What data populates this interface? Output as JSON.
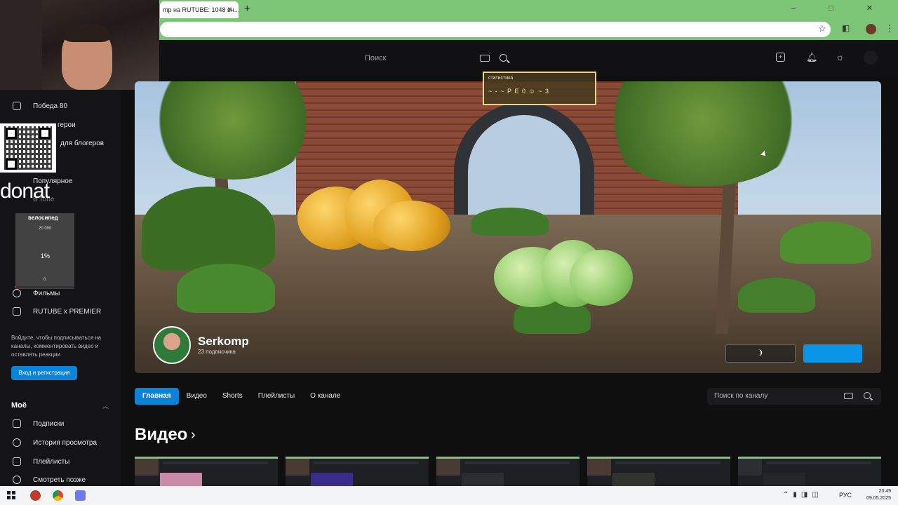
{
  "browser": {
    "tab_title": "mp на RUTUBE: 1048 вн...",
    "tab_close": "×",
    "new_tab": "+",
    "window_controls": "– □ ✕"
  },
  "header": {
    "search_placeholder": "Поиск"
  },
  "sidebar": {
    "items": [
      {
        "label": "Победа 80"
      },
      {
        "label": "герои"
      },
      {
        "label": "для блогеров"
      },
      {
        "label": "Популярное"
      },
      {
        "label": "В топе"
      },
      {
        "label": "Фильмы"
      },
      {
        "label": "RUTUBE x PREMIER"
      }
    ],
    "description": "Войдите, чтобы подписываться на каналы, комментировать видео и оставлять реакции",
    "login_button": "Вход и регистрация",
    "my_section": "Моё",
    "my_items": [
      {
        "label": "Подписки"
      },
      {
        "label": "История просмотра"
      },
      {
        "label": "Плейлисты"
      },
      {
        "label": "Смотреть позже"
      }
    ]
  },
  "overlay": {
    "donat_label": "donat",
    "donat_title": "велосипед",
    "donat_goal": "20 000",
    "donat_percent": "1%",
    "donat_min": "0",
    "donat_progress": 0.01
  },
  "banner": {
    "stats_title": "статистика",
    "stats_text": "~ - ~ Р Е 0 ☺ ~ 3"
  },
  "channel": {
    "name": "Serkomp",
    "subscribers": "23 подписчика",
    "secondary_button_glyph": "❩"
  },
  "tabs": [
    {
      "label": "Главная",
      "active": true
    },
    {
      "label": "Видео",
      "active": false
    },
    {
      "label": "Shorts",
      "active": false
    },
    {
      "label": "Плейлисты",
      "active": false
    },
    {
      "label": "О канале",
      "active": false
    }
  ],
  "channel_search": {
    "placeholder": "Поиск по каналу"
  },
  "section": {
    "title": "Видео"
  },
  "taskbar": {
    "lang": "РУС",
    "time": "23:49",
    "date": "09.05.2025"
  },
  "colors": {
    "accent": "#0a84d8",
    "browser_chrome": "#7cc576",
    "background": "#0f0f10"
  }
}
